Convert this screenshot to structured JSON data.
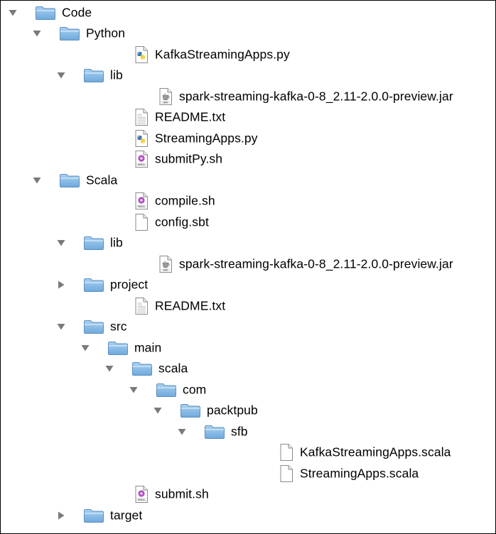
{
  "tree": [
    {
      "label": "Code",
      "type": "folder",
      "depth": 0,
      "expanded": true,
      "icon": "folder-icon"
    },
    {
      "label": "Python",
      "type": "folder",
      "depth": 1,
      "expanded": true,
      "icon": "folder-icon"
    },
    {
      "label": "KafkaStreamingApps.py",
      "type": "python",
      "depth": 2,
      "icon": "python-file-icon"
    },
    {
      "label": "lib",
      "type": "folder",
      "depth": 2,
      "expanded": true,
      "icon": "folder-icon"
    },
    {
      "label": "spark-streaming-kafka-0-8_2.11-2.0.0-preview.jar",
      "type": "jar",
      "depth": 3,
      "icon": "jar-file-icon"
    },
    {
      "label": "README.txt",
      "type": "text",
      "depth": 2,
      "icon": "text-file-icon"
    },
    {
      "label": "StreamingApps.py",
      "type": "python",
      "depth": 2,
      "icon": "python-file-icon"
    },
    {
      "label": "submitPy.sh",
      "type": "shell",
      "depth": 2,
      "icon": "shell-script-icon"
    },
    {
      "label": "Scala",
      "type": "folder",
      "depth": 1,
      "expanded": true,
      "icon": "folder-icon"
    },
    {
      "label": "compile.sh",
      "type": "shell",
      "depth": 2,
      "icon": "shell-script-icon"
    },
    {
      "label": "config.sbt",
      "type": "blank",
      "depth": 2,
      "icon": "document-icon"
    },
    {
      "label": "lib",
      "type": "folder",
      "depth": 2,
      "expanded": true,
      "icon": "folder-icon"
    },
    {
      "label": "spark-streaming-kafka-0-8_2.11-2.0.0-preview.jar",
      "type": "jar",
      "depth": 3,
      "icon": "jar-file-icon"
    },
    {
      "label": "project",
      "type": "folder",
      "depth": 2,
      "expanded": false,
      "icon": "folder-icon"
    },
    {
      "label": "README.txt",
      "type": "text",
      "depth": 2,
      "icon": "text-file-icon"
    },
    {
      "label": "src",
      "type": "folder",
      "depth": 2,
      "expanded": true,
      "icon": "folder-icon"
    },
    {
      "label": "main",
      "type": "folder",
      "depth": 3,
      "expanded": true,
      "icon": "folder-icon"
    },
    {
      "label": "scala",
      "type": "folder",
      "depth": 4,
      "expanded": true,
      "icon": "folder-icon"
    },
    {
      "label": "com",
      "type": "folder",
      "depth": 5,
      "expanded": true,
      "icon": "folder-icon"
    },
    {
      "label": "packtpub",
      "type": "folder",
      "depth": 6,
      "expanded": true,
      "icon": "folder-icon"
    },
    {
      "label": "sfb",
      "type": "folder",
      "depth": 7,
      "expanded": true,
      "icon": "folder-icon"
    },
    {
      "label": "KafkaStreamingApps.scala",
      "type": "blank",
      "depth": 8,
      "icon": "document-icon"
    },
    {
      "label": "StreamingApps.scala",
      "type": "blank",
      "depth": 8,
      "icon": "document-icon"
    },
    {
      "label": "submit.sh",
      "type": "shell",
      "depth": 2,
      "icon": "shell-script-icon"
    },
    {
      "label": "target",
      "type": "folder",
      "depth": 2,
      "expanded": false,
      "icon": "folder-icon"
    }
  ],
  "colors": {
    "folder_top": "#a9d1f0",
    "folder_bottom": "#6fa9dc",
    "folder_edge": "#5b8fbf",
    "arrow": "#7a7a7a",
    "python_blue": "#3d78b0",
    "python_yellow": "#f3cf3a",
    "shell_purple": "#b04fc0",
    "jar_red": "#c0392b"
  }
}
